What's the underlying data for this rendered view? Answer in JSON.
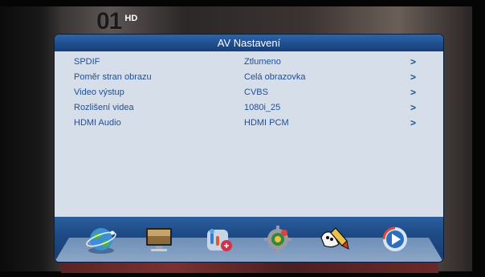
{
  "channel": {
    "logo": "01",
    "badge": "HD"
  },
  "dialog": {
    "title": "AV Nastavení",
    "rows": [
      {
        "label": "SPDIF",
        "value": "Ztlumeno",
        "arrow": ">"
      },
      {
        "label": "Poměr stran obrazu",
        "value": "Celá obrazovka",
        "arrow": ">"
      },
      {
        "label": "Video výstup",
        "value": "CVBS",
        "arrow": ">"
      },
      {
        "label": "Rozlišení videa",
        "value": "1080i_25",
        "arrow": ">"
      },
      {
        "label": "HDMI Audio",
        "value": "HDMI PCM",
        "arrow": ">"
      }
    ]
  },
  "icon_bar": {
    "items": [
      {
        "icon": "globe-satellite-icon"
      },
      {
        "icon": "monitor-icon"
      },
      {
        "icon": "media-tools-icon"
      },
      {
        "icon": "settings-gear-icon"
      },
      {
        "icon": "tools-pencil-icon",
        "selected": true
      },
      {
        "icon": "play-circle-icon"
      }
    ]
  },
  "colors": {
    "header": "#1f4e8f",
    "body": "#d6deea",
    "text": "#1f4f96",
    "icon_bar": "#1d4a85"
  }
}
